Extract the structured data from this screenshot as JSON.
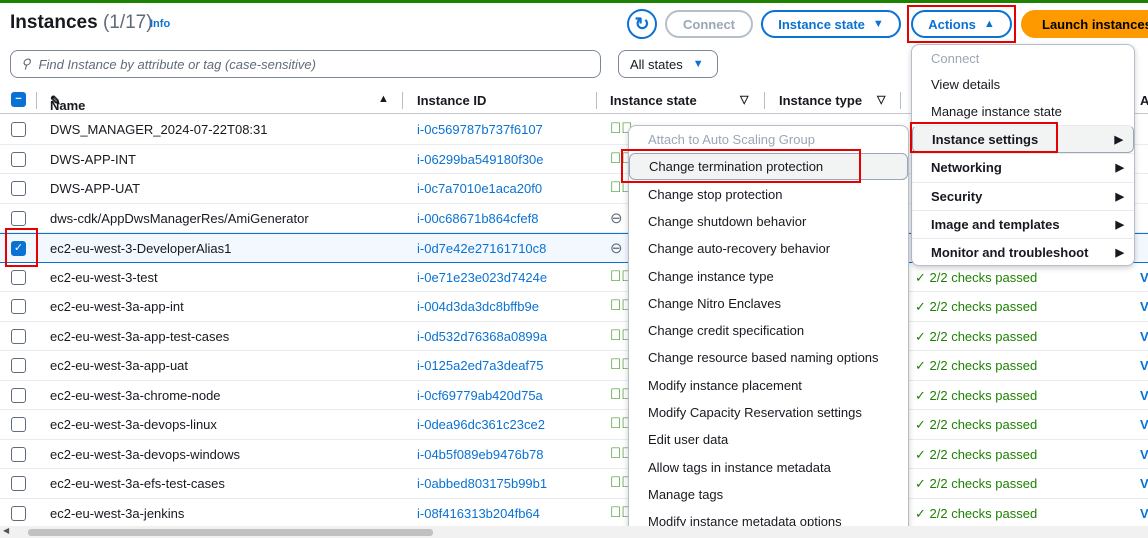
{
  "header": {
    "title": "Instances",
    "count": "(1/17)",
    "info": "Info"
  },
  "toolbar": {
    "connect": "Connect",
    "instance_state": "Instance state",
    "actions": "Actions",
    "launch": "Launch instances"
  },
  "search": {
    "placeholder": "Find Instance by attribute or tag (case-sensitive)"
  },
  "filter": {
    "selected": "All states"
  },
  "columns": [
    "Name",
    "Instance ID",
    "Instance state",
    "Instance type",
    "A"
  ],
  "rows": [
    {
      "name": "DWS_MANAGER_2024-07-22T08:31",
      "id": "i-0c569787b737f6107",
      "state": "running"
    },
    {
      "name": "DWS-APP-INT",
      "id": "i-06299ba549180f30e",
      "state": "running"
    },
    {
      "name": "DWS-APP-UAT",
      "id": "i-0c7a7010e1aca20f0",
      "state": "running"
    },
    {
      "name": "dws-cdk/AppDwsManagerRes/AmiGenerator",
      "id": "i-00c68671b864cfef8",
      "state": "stopped"
    },
    {
      "name": "ec2-eu-west-3-DeveloperAlias1",
      "id": "i-0d7e42e27161710c8",
      "state": "stopped",
      "selected": true
    },
    {
      "name": "ec2-eu-west-3-test",
      "id": "i-0e71e23e023d7424e",
      "state": "running",
      "checks": "2/2 checks passed",
      "link": "V"
    },
    {
      "name": "ec2-eu-west-3a-app-int",
      "id": "i-004d3da3dc8bffb9e",
      "state": "running",
      "checks": "2/2 checks passed",
      "link": "V"
    },
    {
      "name": "ec2-eu-west-3a-app-test-cases",
      "id": "i-0d532d76368a0899a",
      "state": "running",
      "checks": "2/2 checks passed",
      "link": "V"
    },
    {
      "name": "ec2-eu-west-3a-app-uat",
      "id": "i-0125a2ed7a3deaf75",
      "state": "running",
      "checks": "2/2 checks passed",
      "link": "V"
    },
    {
      "name": "ec2-eu-west-3a-chrome-node",
      "id": "i-0cf69779ab420d75a",
      "state": "running",
      "checks": "2/2 checks passed",
      "link": "V"
    },
    {
      "name": "ec2-eu-west-3a-devops-linux",
      "id": "i-0dea96dc361c23ce2",
      "state": "running",
      "checks": "2/2 checks passed",
      "link": "V"
    },
    {
      "name": "ec2-eu-west-3a-devops-windows",
      "id": "i-04b5f089eb9476b78",
      "state": "running",
      "checks": "2/2 checks passed",
      "link": "V"
    },
    {
      "name": "ec2-eu-west-3a-efs-test-cases",
      "id": "i-0abbed803175b99b1",
      "state": "running",
      "checks": "2/2 checks passed",
      "link": "V"
    },
    {
      "name": "ec2-eu-west-3a-jenkins",
      "id": "i-08f416313b204fb64",
      "state": "running",
      "checks": "2/2 checks passed",
      "link": "V"
    }
  ],
  "actions_menu": {
    "plain": [
      "Connect",
      "View details",
      "Manage instance state"
    ],
    "groups": [
      "Instance settings",
      "Networking",
      "Security",
      "Image and templates",
      "Monitor and troubleshoot"
    ]
  },
  "settings_submenu": [
    "Attach to Auto Scaling Group",
    "Change termination protection",
    "Change stop protection",
    "Change shutdown behavior",
    "Change auto-recovery behavior",
    "Change instance type",
    "Change Nitro Enclaves",
    "Change credit specification",
    "Change resource based naming options",
    "Modify instance placement",
    "Modify Capacity Reservation settings",
    "Edit user data",
    "Allow tags in instance metadata",
    "Manage tags",
    "Modify instance metadata options"
  ]
}
